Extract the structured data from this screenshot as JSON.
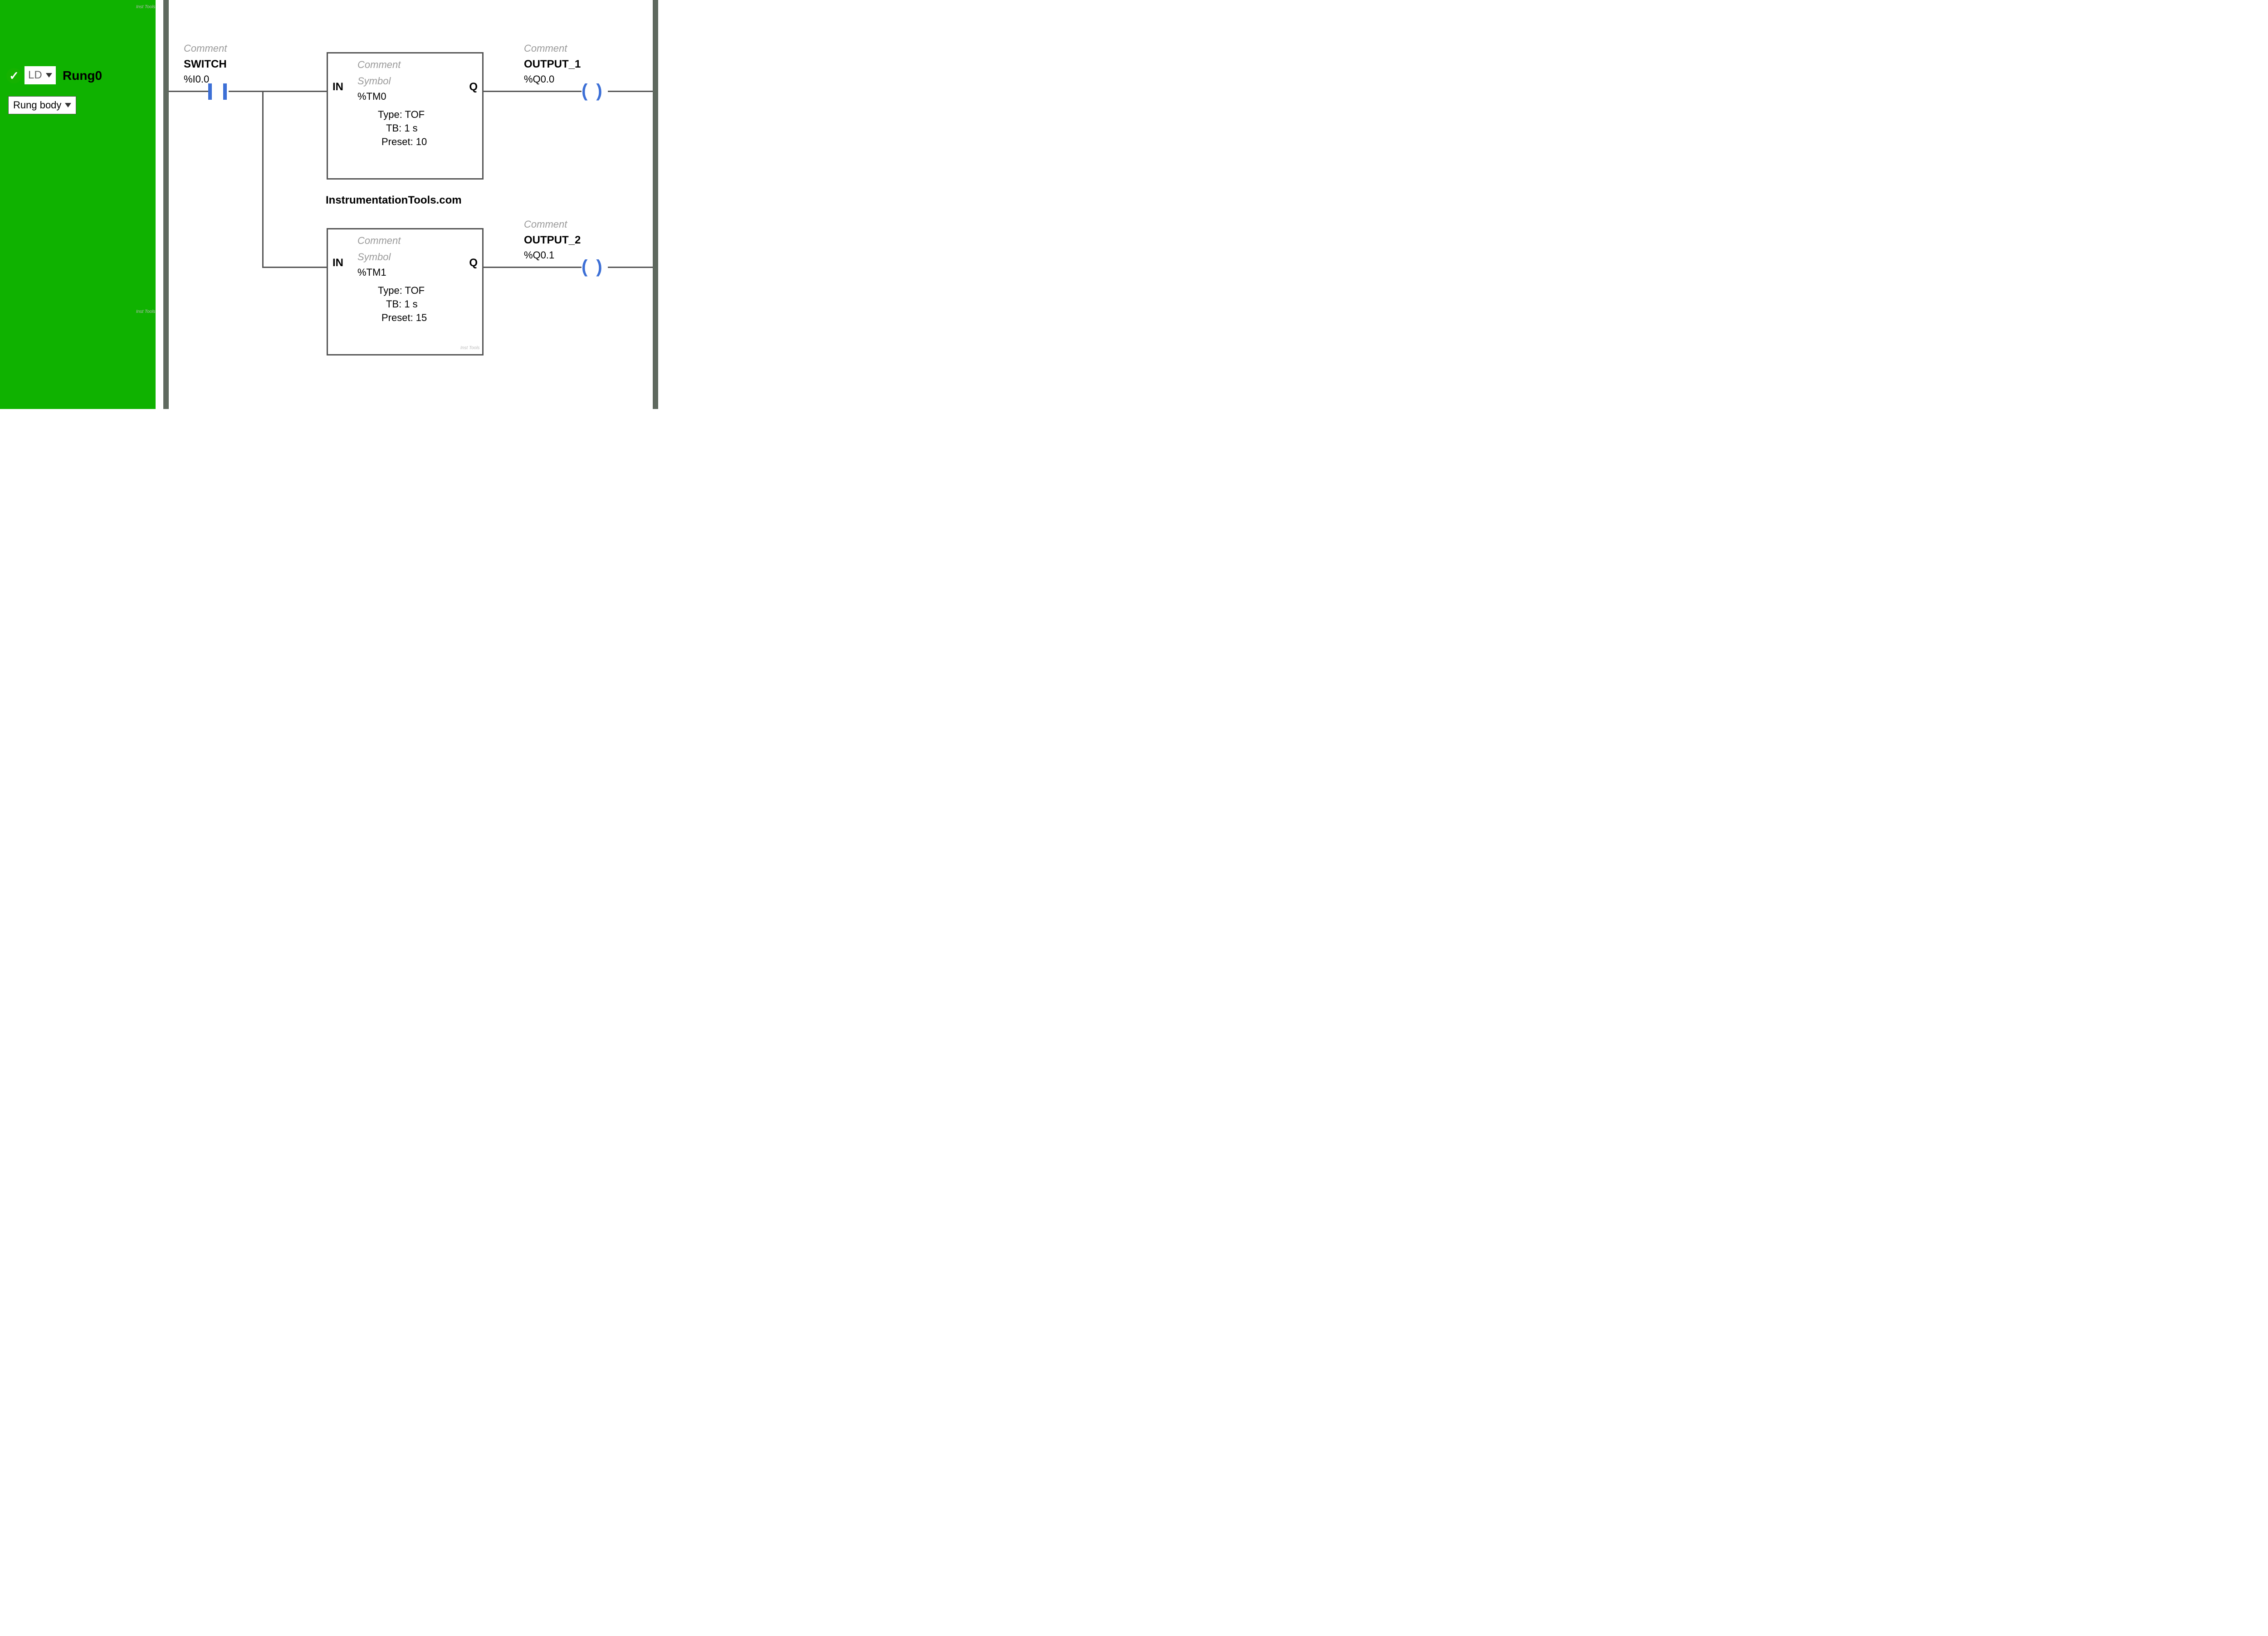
{
  "sidebar": {
    "check_glyph": "✓",
    "lang_label": "LD",
    "rung_title": "Rung0",
    "rung_body_label": "Rung body"
  },
  "contact": {
    "comment": "Comment",
    "name": "SWITCH",
    "address": "%I0.0"
  },
  "timer0": {
    "in": "IN",
    "q": "Q",
    "comment": "Comment",
    "symbol": "Symbol",
    "address": "%TM0",
    "type": "Type: TOF",
    "tb": "TB: 1 s",
    "preset": "Preset: 10"
  },
  "timer1": {
    "in": "IN",
    "q": "Q",
    "comment": "Comment",
    "symbol": "Symbol",
    "address": "%TM1",
    "type": "Type: TOF",
    "tb": "TB: 1 s",
    "preset": "Preset: 15"
  },
  "coil0": {
    "comment": "Comment",
    "name": "OUTPUT_1",
    "address": "%Q0.0",
    "glyph": "(   )"
  },
  "coil1": {
    "comment": "Comment",
    "name": "OUTPUT_2",
    "address": "%Q0.1",
    "glyph": "(   )"
  },
  "brand": "InstrumentationTools.com",
  "wm": "Inst Tools"
}
